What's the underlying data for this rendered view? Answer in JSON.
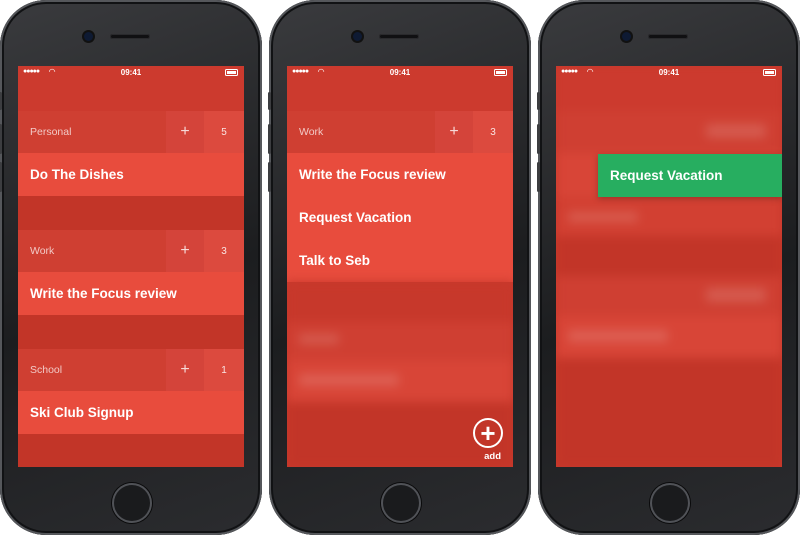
{
  "status_bar": {
    "signal": "●●●●●",
    "time": "09:41"
  },
  "screen1": {
    "groups": [
      {
        "title": "Personal",
        "plus": "+",
        "count": "5",
        "task": "Do The Dishes"
      },
      {
        "title": "Work",
        "plus": "+",
        "count": "3",
        "task": "Write the Focus review"
      },
      {
        "title": "School",
        "plus": "+",
        "count": "1",
        "task": "Ski Club Signup"
      }
    ]
  },
  "screen2": {
    "group": {
      "title": "Work",
      "plus": "+",
      "count": "3"
    },
    "tasks": [
      "Write the Focus review",
      "Request Vacation",
      "Talk to Seb"
    ],
    "add_button": {
      "icon": "+",
      "label": "add"
    }
  },
  "screen3": {
    "dragging_task": "Request Vacation"
  },
  "colors": {
    "accent_red": "#e84c3d",
    "header_red": "#cf3f32",
    "background_red": "#c9392c",
    "drag_green": "#27ae60"
  }
}
